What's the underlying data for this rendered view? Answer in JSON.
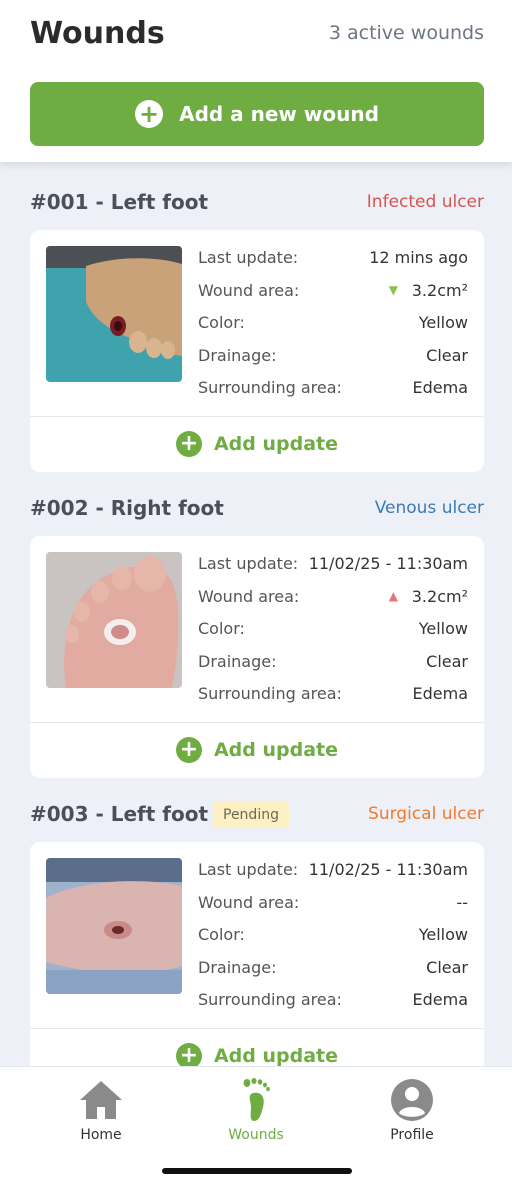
{
  "header": {
    "title": "Wounds",
    "active_count": "3 active wounds",
    "add_button_label": "Add a new wound"
  },
  "wounds": [
    {
      "title": "#001 - Left foot",
      "type": "Infected ulcer",
      "type_color": "#d9534f",
      "pending": "",
      "rows": [
        {
          "label": "Last update:",
          "value": "12 mins ago"
        },
        {
          "label": "Wound area:",
          "value": "3.2cm²",
          "trend": "down"
        },
        {
          "label": "Color:",
          "value": "Yellow"
        },
        {
          "label": "Drainage:",
          "value": "Clear"
        },
        {
          "label": "Surrounding area:",
          "value": "Edema"
        }
      ],
      "add_update_label": "Add update"
    },
    {
      "title": "#002 - Right foot",
      "type": "Venous ulcer",
      "type_color": "#3a7ab8",
      "pending": "",
      "rows": [
        {
          "label": "Last update:",
          "value": "11/02/25 - 11:30am"
        },
        {
          "label": "Wound area:",
          "value": "3.2cm²",
          "trend": "up"
        },
        {
          "label": "Color:",
          "value": "Yellow"
        },
        {
          "label": "Drainage:",
          "value": "Clear"
        },
        {
          "label": "Surrounding area:",
          "value": "Edema"
        }
      ],
      "add_update_label": "Add update"
    },
    {
      "title": "#003 - Left foot",
      "type": "Surgical ulcer",
      "type_color": "#ef7a2c",
      "pending": "Pending",
      "rows": [
        {
          "label": "Last update:",
          "value": "11/02/25 - 11:30am"
        },
        {
          "label": "Wound area:",
          "value": "--"
        },
        {
          "label": "Color:",
          "value": "Yellow"
        },
        {
          "label": "Drainage:",
          "value": "Clear"
        },
        {
          "label": "Surrounding area:",
          "value": "Edema"
        }
      ],
      "add_update_label": "Add update"
    }
  ],
  "nav": {
    "home": "Home",
    "wounds": "Wounds",
    "profile": "Profile"
  },
  "colors": {
    "accent": "#6fad43",
    "trend_down": "#8bc34a",
    "trend_up": "#e57373",
    "inactive_nav": "#8a8a8a"
  }
}
